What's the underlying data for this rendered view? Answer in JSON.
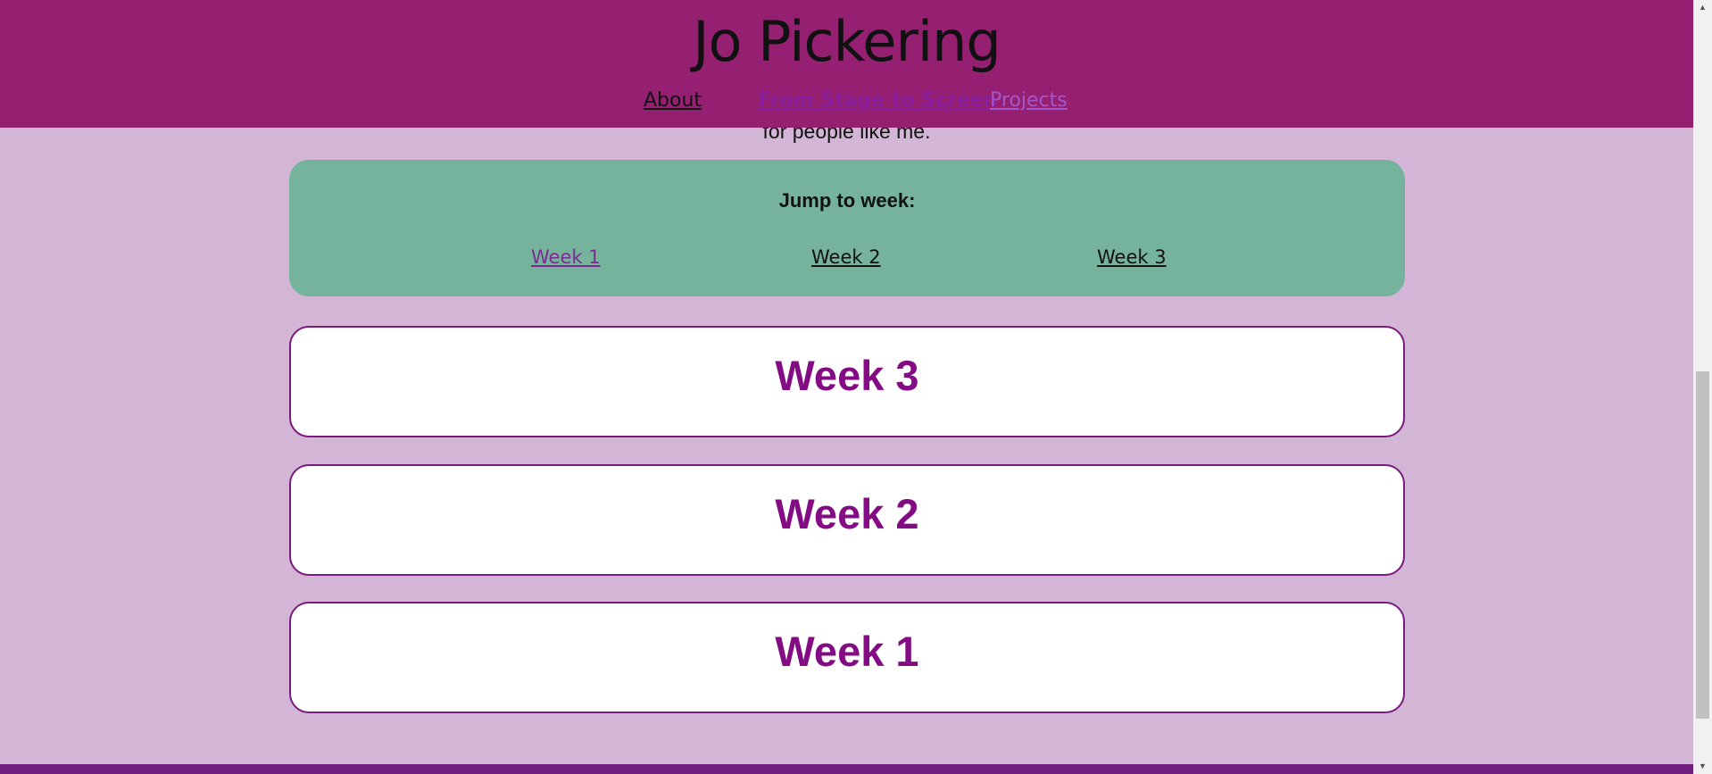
{
  "header": {
    "title": "Jo Pickering",
    "nav": [
      {
        "label": "About"
      },
      {
        "label": "From Stage to Screen"
      },
      {
        "label": "Projects"
      }
    ]
  },
  "intro": {
    "fragment": "for people like me."
  },
  "jump": {
    "heading": "Jump to week:",
    "links": [
      "Week 1",
      "Week 2",
      "Week 3"
    ]
  },
  "weeks": [
    {
      "title": "Week 3"
    },
    {
      "title": "Week 2"
    },
    {
      "title": "Week 1"
    }
  ],
  "colors": {
    "header_bg": "#951f71",
    "page_bg": "#d3b5d6",
    "jump_bg": "#76b39d",
    "week_title": "#830b83",
    "card_border": "#7a1a7f"
  },
  "scrollbar": {
    "up_icon": "scroll-up-arrow-icon",
    "down_icon": "scroll-down-arrow-icon"
  }
}
